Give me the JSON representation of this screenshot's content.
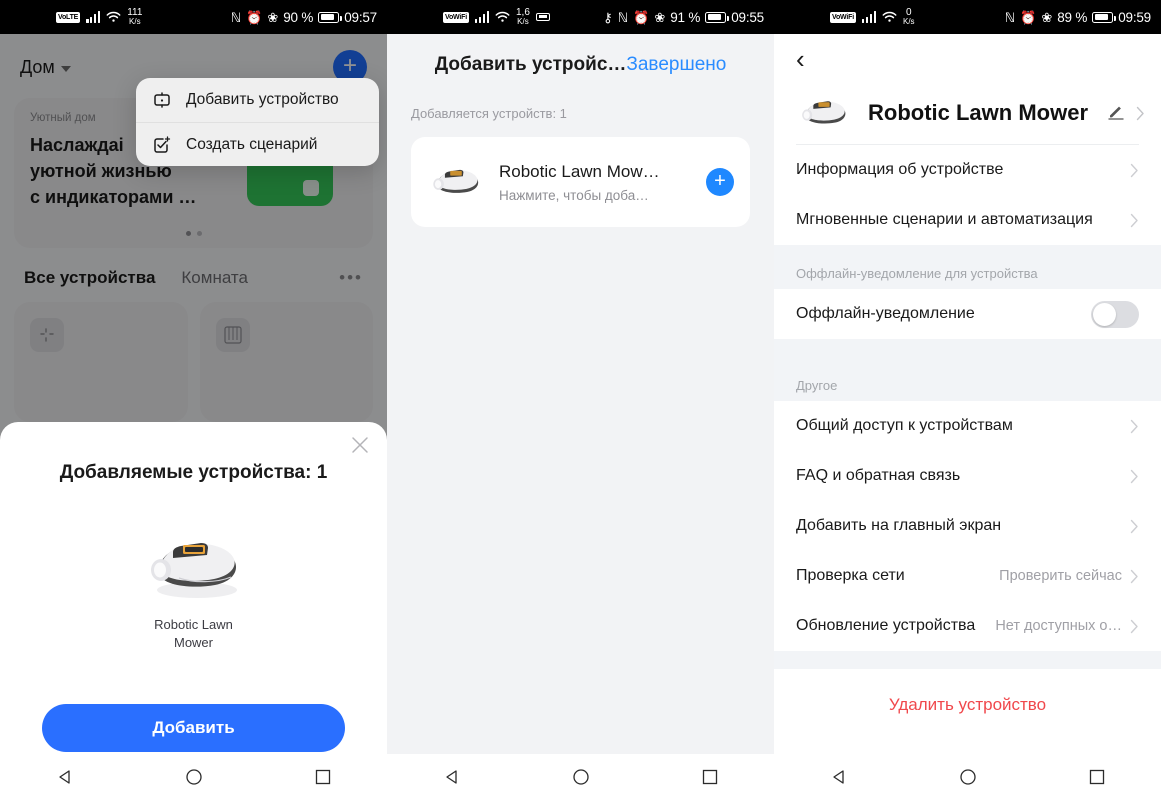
{
  "screen1": {
    "statusbar": {
      "network_type": "VoLTE",
      "speed_value": "111",
      "speed_unit": "K/s",
      "battery": "90 %",
      "time": "09:57",
      "icons": [
        "nfc-icon",
        "alarm-icon",
        "bluetooth-icon",
        "battery-icon"
      ]
    },
    "home_label": "Дом",
    "promo": {
      "subtitle": "Уютный дом",
      "line1": "Наслаждаі",
      "line2": "уютной жизнью",
      "line3": "с индикаторами …"
    },
    "tabs": {
      "all_devices": "Все устройства",
      "room": "Комната",
      "more": "•••"
    },
    "popup_menu": [
      {
        "label": "Добавить устройство",
        "icon": "add-device-icon"
      },
      {
        "label": "Создать сценарий",
        "icon": "create-scene-icon"
      }
    ],
    "sheet": {
      "title": "Добавляемые устройства: 1",
      "device_name_line1": "Robotic Lawn",
      "device_name_line2": "Mower",
      "button": "Добавить",
      "close": "close-icon"
    }
  },
  "screen2": {
    "statusbar": {
      "network_type": "VoWiFi",
      "speed_value": "1,6",
      "speed_unit": "K/s",
      "battery": "91 %",
      "time": "09:55",
      "icons": [
        "usb-icon",
        "key-icon",
        "nfc-icon",
        "alarm-icon",
        "bluetooth-icon",
        "battery-icon"
      ]
    },
    "title": "Добавить устройс…",
    "done": "Завершено",
    "count_text": "Добавляется устройств: 1",
    "card": {
      "name": "Robotic Lawn Mow…",
      "hint": "Нажмите, чтобы доба…",
      "action": "add-icon"
    }
  },
  "screen3": {
    "statusbar": {
      "network_type": "VoWiFi",
      "speed_value": "0",
      "speed_unit": "K/s",
      "battery": "89 %",
      "time": "09:59",
      "icons": [
        "nfc-icon",
        "alarm-icon",
        "bluetooth-icon",
        "battery-icon"
      ]
    },
    "back": "‹",
    "device_title": "Robotic Lawn Mower",
    "rows_top": [
      {
        "label": "Информация об устройстве"
      },
      {
        "label": "Мгновенные сценарии и автоматизация"
      }
    ],
    "group_offline": "Оффлайн-уведомление для устройства",
    "offline_row": {
      "label": "Оффлайн-уведомление",
      "toggle_on": false
    },
    "group_other": "Другое",
    "rows_other": [
      {
        "label": "Общий доступ к устройствам",
        "value": ""
      },
      {
        "label": "FAQ и обратная связь",
        "value": ""
      },
      {
        "label": "Добавить на главный экран",
        "value": ""
      },
      {
        "label": "Проверка сети",
        "value": "Проверить сейчас"
      },
      {
        "label": "Обновление устройства",
        "value": "Нет доступных о…"
      }
    ],
    "delete_label": "Удалить устройство"
  },
  "navbar": {
    "back": "back-triangle-icon",
    "home": "home-circle-icon",
    "recents": "recents-square-icon"
  },
  "colors": {
    "accent_blue": "#2a6fff",
    "link_blue": "#2a8cff",
    "danger_red": "#f0484c",
    "bg_gray": "#f2f3f5",
    "group_gray": "#f2f4f7"
  }
}
